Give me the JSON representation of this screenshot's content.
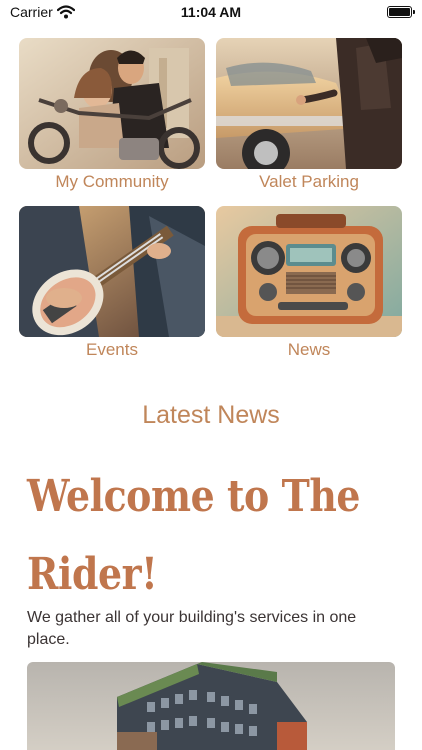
{
  "status_bar": {
    "carrier": "Carrier",
    "time": "11:04 AM",
    "icons": [
      "wifi-icon",
      "battery-icon"
    ]
  },
  "tiles": [
    {
      "label": "My Community"
    },
    {
      "label": "Valet Parking"
    },
    {
      "label": "Events"
    },
    {
      "label": "News"
    }
  ],
  "section": {
    "title": "Latest News"
  },
  "article": {
    "headline": "Welcome to The Rider!",
    "intro": "We gather all of your building's services in one place."
  },
  "colors": {
    "accent": "#c0865a",
    "headline": "#c0764d",
    "body_text": "#3b3434"
  }
}
